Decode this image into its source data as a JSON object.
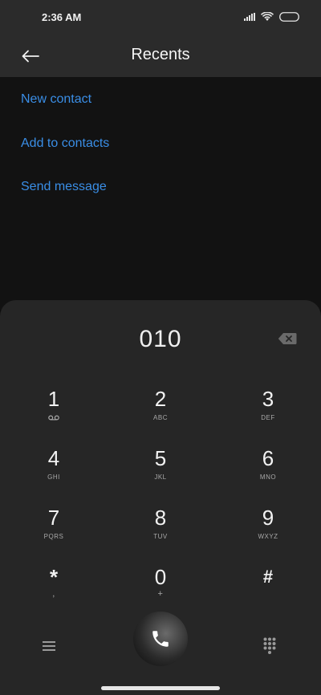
{
  "status": {
    "time": "2:36 AM"
  },
  "header": {
    "title": "Recents"
  },
  "actions": {
    "new_contact": "New contact",
    "add_to_contacts": "Add to contacts",
    "send_message": "Send message"
  },
  "dialer": {
    "number": "010",
    "keys": [
      {
        "digit": "1",
        "letters": ""
      },
      {
        "digit": "2",
        "letters": "ABC"
      },
      {
        "digit": "3",
        "letters": "DEF"
      },
      {
        "digit": "4",
        "letters": "GHI"
      },
      {
        "digit": "5",
        "letters": "JKL"
      },
      {
        "digit": "6",
        "letters": "MNO"
      },
      {
        "digit": "7",
        "letters": "PQRS"
      },
      {
        "digit": "8",
        "letters": "TUV"
      },
      {
        "digit": "9",
        "letters": "WXYZ"
      },
      {
        "digit": "*",
        "letters": ","
      },
      {
        "digit": "0",
        "letters": "+"
      },
      {
        "digit": "#",
        "letters": ""
      }
    ]
  },
  "colors": {
    "accent": "#3a8ee6",
    "background": "#121212",
    "dialpad": "#262626",
    "bar": "#2b2b2b"
  },
  "icons": {
    "back": "back-arrow-icon",
    "backspace": "backspace-icon",
    "voicemail": "voicemail-icon",
    "menu": "menu-icon",
    "call": "phone-icon",
    "keypad": "dialpad-icon"
  }
}
